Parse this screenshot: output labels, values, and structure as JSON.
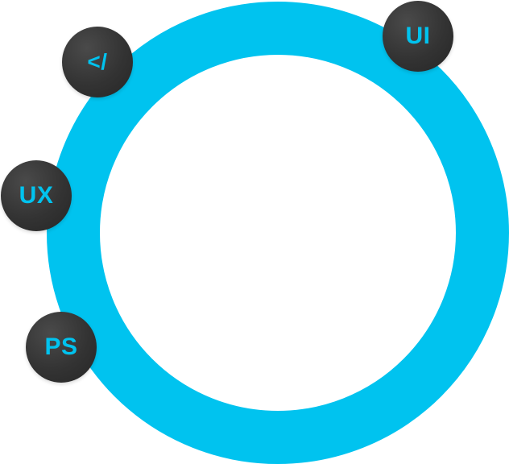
{
  "colors": {
    "ring": "#00c3ef",
    "badge_background": "#333333",
    "badge_text": "#00c3ef"
  },
  "badges": [
    {
      "id": "ui",
      "label": "UI"
    },
    {
      "id": "code",
      "label": "</>",
      "display": "</"
    },
    {
      "id": "ux",
      "label": "UX"
    },
    {
      "id": "ps",
      "label": "PS"
    }
  ]
}
